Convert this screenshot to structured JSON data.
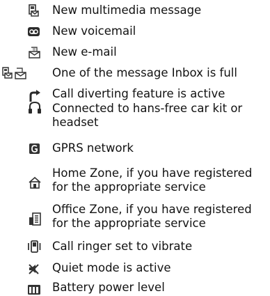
{
  "entries": [
    {
      "icon": "multimedia-message-icon",
      "text": "New multimedia message"
    },
    {
      "icon": "voicemail-icon",
      "text": "New voicemail"
    },
    {
      "icon": "email-icon",
      "text": "New e-mail"
    },
    {
      "icon": "inbox-full-icon",
      "text": "One of the message Inbox is full"
    },
    {
      "icon": "call-divert-icon",
      "text": "Call diverting feature is active"
    },
    {
      "icon": "headset-icon",
      "text_line1": "Connected to hans-free car kit or",
      "text_line2": "headset"
    },
    {
      "icon": "gprs-icon",
      "text": "GPRS network"
    },
    {
      "icon": "home-zone-icon",
      "text_line1": "Home Zone, if you have registered",
      "text_line2": "for the appropriate service"
    },
    {
      "icon": "office-zone-icon",
      "text_line1": "Office Zone, if you have registered",
      "text_line2": "for the appropriate service"
    },
    {
      "icon": "vibrate-icon",
      "text": "Call ringer set to vibrate"
    },
    {
      "icon": "quiet-mode-icon",
      "text": "Quiet mode is active"
    },
    {
      "icon": "battery-icon",
      "text": "Battery power level"
    }
  ]
}
